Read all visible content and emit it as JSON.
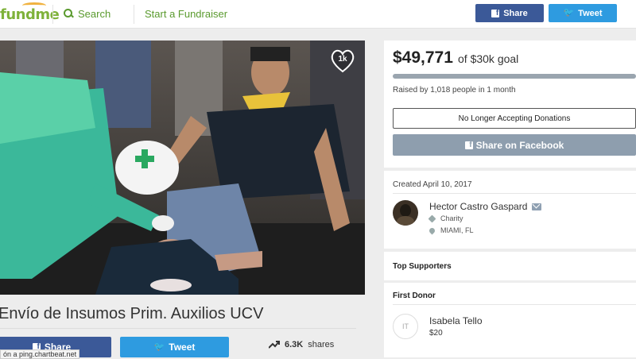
{
  "header": {
    "logo_text": "fundme",
    "search_label": "Search",
    "start_label": "Start a Fundraiser",
    "share_label": "Share",
    "tweet_label": "Tweet"
  },
  "photo": {
    "heart_count": "1k"
  },
  "campaign": {
    "title": "Envío de Insumos Prim. Auxilios UCV",
    "share_label": "Share",
    "tweet_label": "Tweet",
    "shares_count": "6.3K",
    "shares_label": "shares"
  },
  "status_bar_text": "ón a ping.chartbeat.net",
  "sidebar": {
    "amount": "$49,771",
    "goal_text": "of $30k goal",
    "progress_fraction": 1.0,
    "raised_text": "Raised by 1,018 people in 1 month",
    "closed_label": "No Longer Accepting Donations",
    "share_fb_label": "Share on Facebook",
    "created": "Created April 10, 2017",
    "organizer": "Hector Castro Gaspard",
    "category": "Charity",
    "location": "MIAMI, FL",
    "top_supporters": "Top Supporters",
    "first_donor_title": "First Donor",
    "donor_initials": "IT",
    "donor_name": "Isabela Tello",
    "donor_amount": "$20"
  },
  "colors": {
    "brand_green": "#7fb23a",
    "facebook": "#3b5998",
    "twitter": "#2e9be0",
    "disabled_share": "#8e9eae"
  }
}
